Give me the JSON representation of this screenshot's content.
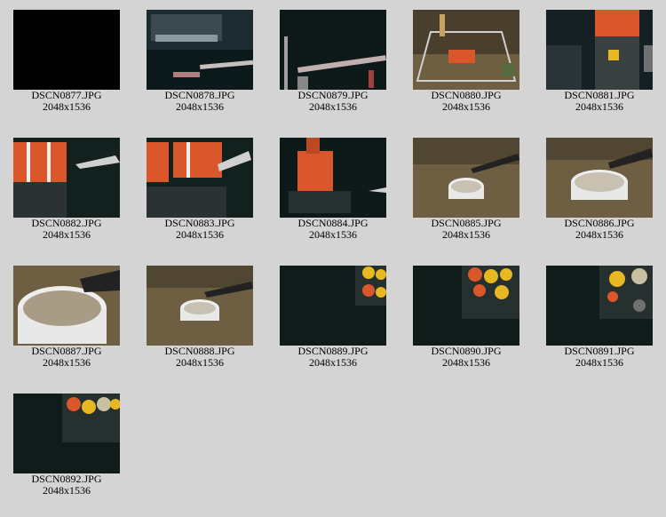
{
  "gallery": {
    "items": [
      {
        "name": "DSCN0877.JPG",
        "size": "2048x1536",
        "icon": "dark-underwater-photo"
      },
      {
        "name": "DSCN0878.JPG",
        "size": "2048x1536",
        "icon": "robotic-arm-photo"
      },
      {
        "name": "DSCN0879.JPG",
        "size": "2048x1536",
        "icon": "robotic-arm-photo"
      },
      {
        "name": "DSCN0880.JPG",
        "size": "2048x1536",
        "icon": "lander-frame-photo"
      },
      {
        "name": "DSCN0881.JPG",
        "size": "2048x1536",
        "icon": "orange-lander-photo"
      },
      {
        "name": "DSCN0882.JPG",
        "size": "2048x1536",
        "icon": "orange-lander-photo"
      },
      {
        "name": "DSCN0883.JPG",
        "size": "2048x1536",
        "icon": "orange-lander-photo"
      },
      {
        "name": "DSCN0884.JPG",
        "size": "2048x1536",
        "icon": "orange-lander-photo"
      },
      {
        "name": "DSCN0885.JPG",
        "size": "2048x1536",
        "icon": "sample-container-photo"
      },
      {
        "name": "DSCN0886.JPG",
        "size": "2048x1536",
        "icon": "sample-container-photo"
      },
      {
        "name": "DSCN0887.JPG",
        "size": "2048x1536",
        "icon": "sample-container-photo"
      },
      {
        "name": "DSCN0888.JPG",
        "size": "2048x1536",
        "icon": "sample-container-photo"
      },
      {
        "name": "DSCN0889.JPG",
        "size": "2048x1536",
        "icon": "float-rack-photo"
      },
      {
        "name": "DSCN0890.JPG",
        "size": "2048x1536",
        "icon": "float-rack-photo"
      },
      {
        "name": "DSCN0891.JPG",
        "size": "2048x1536",
        "icon": "float-rack-photo"
      },
      {
        "name": "DSCN0892.JPG",
        "size": "2048x1536",
        "icon": "float-rack-photo"
      }
    ]
  },
  "colors": {
    "background": "#d4d4d4",
    "seabed": "#6b5a3e",
    "water": "#0f1c1a",
    "orange": "#d9572a",
    "yellow": "#e8b820"
  }
}
